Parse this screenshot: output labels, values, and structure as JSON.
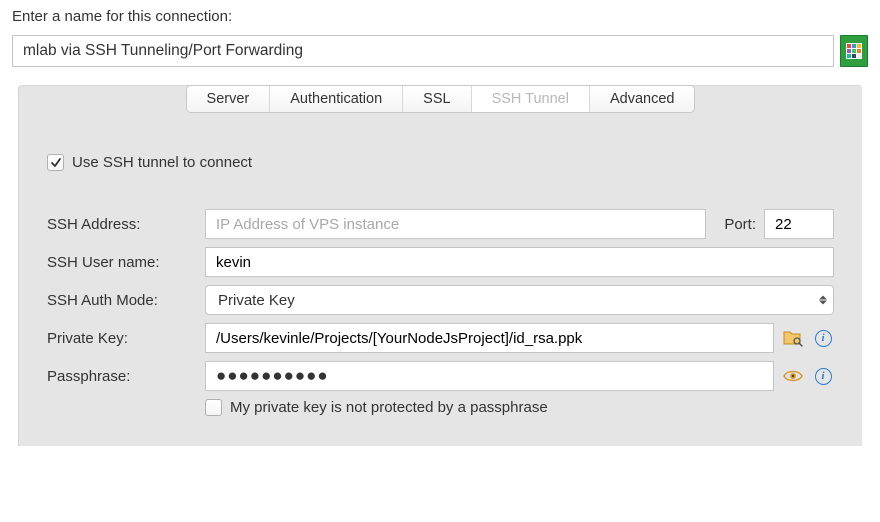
{
  "header": {
    "prompt": "Enter a name for this connection:",
    "connection_name": "mlab via SSH Tunneling/Port Forwarding"
  },
  "tabs": {
    "server": "Server",
    "authentication": "Authentication",
    "ssl": "SSL",
    "ssh_tunnel": "SSH Tunnel",
    "advanced": "Advanced",
    "active": "ssh_tunnel"
  },
  "ssh": {
    "use_tunnel_label": "Use SSH tunnel to connect",
    "use_tunnel_checked": true,
    "address_label": "SSH Address:",
    "address_placeholder": "IP Address of VPS instance",
    "address_value": "",
    "port_label": "Port:",
    "port_value": "22",
    "user_label": "SSH User name:",
    "user_value": "kevin",
    "auth_mode_label": "SSH Auth Mode:",
    "auth_mode_value": "Private Key",
    "private_key_label": "Private Key:",
    "private_key_value": "/Users/kevinle/Projects/[YourNodeJsProject]/id_rsa.ppk",
    "passphrase_label": "Passphrase:",
    "passphrase_masked": "●●●●●●●●●●",
    "no_passphrase_label": "My private key is not protected by a passphrase",
    "no_passphrase_checked": false
  }
}
